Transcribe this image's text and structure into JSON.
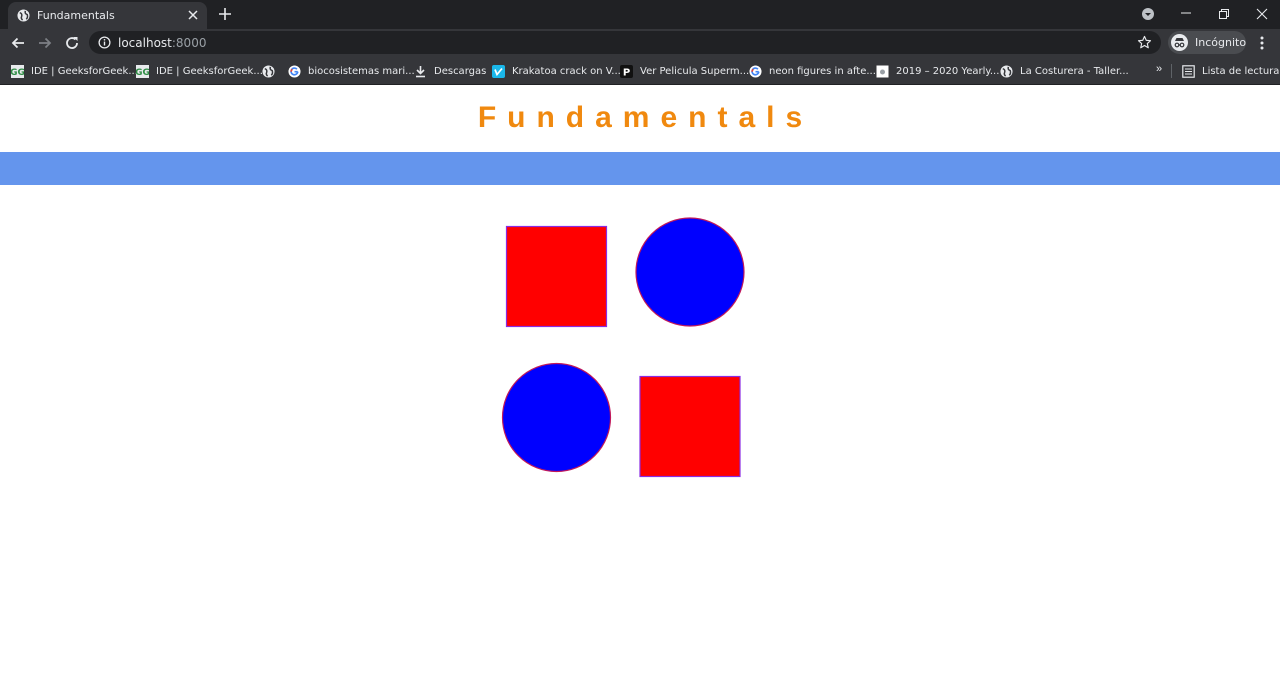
{
  "browser": {
    "tab": {
      "title": "Fundamentals"
    },
    "address": {
      "host": "localhost",
      "port": ":8000"
    },
    "profile": {
      "label": "Incógnito"
    },
    "bookmarks": [
      {
        "label": "IDE | GeeksforGeek...",
        "icon": "geeksforgeeks-icon"
      },
      {
        "label": "IDE | GeeksforGeek...",
        "icon": "geeksforgeeks-icon"
      },
      {
        "label": "",
        "icon": "globe-icon"
      },
      {
        "label": "biocosistemas mari...",
        "icon": "google-icon"
      },
      {
        "label": "Descargas",
        "icon": "download-icon"
      },
      {
        "label": "Krakatoa crack on V...",
        "icon": "vimeo-icon"
      },
      {
        "label": "Ver Pelicula Superm...",
        "icon": "p-icon"
      },
      {
        "label": "neon figures in afte...",
        "icon": "google-icon"
      },
      {
        "label": "2019 – 2020 Yearly...",
        "icon": "doc-icon"
      },
      {
        "label": "La Costurera - Taller...",
        "icon": "globe-icon"
      }
    ],
    "bookmarks_more": "»",
    "reading_list": "Lista de lectura"
  },
  "page": {
    "title": "Fundamentals",
    "colors": {
      "title": "#f0890f",
      "band": "#6495ed",
      "square": "#ff0000",
      "circle": "#0000ff",
      "outline": "#8a2be2"
    },
    "shapes": [
      {
        "kind": "square",
        "row": 1,
        "col": 1
      },
      {
        "kind": "circle",
        "row": 1,
        "col": 2
      },
      {
        "kind": "circle",
        "row": 2,
        "col": 1
      },
      {
        "kind": "square",
        "row": 2,
        "col": 2
      }
    ]
  }
}
